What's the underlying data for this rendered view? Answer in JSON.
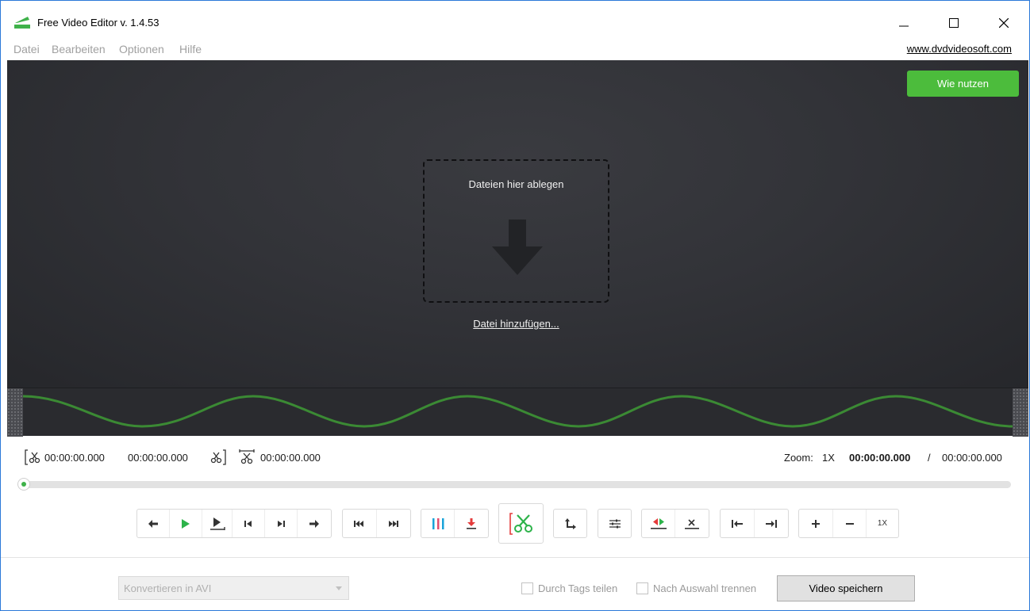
{
  "window": {
    "title": "Free Video Editor v. 1.4.53",
    "accent": "#2b79d8"
  },
  "menu": {
    "items": [
      {
        "label": "Datei"
      },
      {
        "label": "Bearbeiten"
      },
      {
        "label": "Optionen"
      },
      {
        "label": "Hilfe"
      }
    ],
    "site_link": "www.dvdvideosoft.com"
  },
  "preview": {
    "how_button": "Wie nutzen",
    "drop_text": "Dateien hier ablegen",
    "add_file": "Datei hinzufügen...",
    "brand_green": "#4cbc3c"
  },
  "timebar": {
    "cut_start": "00:00:00.000",
    "cut_end": "00:00:00.000",
    "cut_length": "00:00:00.000",
    "zoom_label": "Zoom:",
    "zoom_value": "1X",
    "current_time": "00:00:00.000",
    "separator": "/",
    "total_time": "00:00:00.000"
  },
  "playback": {
    "position": 0
  },
  "controls": {
    "zoom_reset_label": "1X"
  },
  "bottom": {
    "format_select": "Konvertieren in AVI",
    "split_by_tags": "Durch Tags teilen",
    "split_by_selection": "Nach Auswahl trennen",
    "save_button": "Video speichern"
  }
}
